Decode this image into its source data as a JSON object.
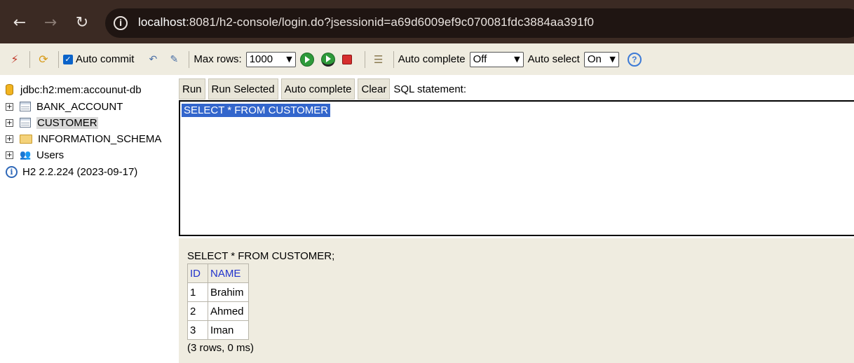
{
  "browser": {
    "url_host": "localhost",
    "url_rest": ":8081/h2-console/login.do?jsessionid=a69d6009ef9c070081fdc3884aa391f0"
  },
  "toolbar": {
    "auto_commit_label": "Auto commit",
    "max_rows_label": "Max rows:",
    "max_rows_value": "1000",
    "auto_complete_label": "Auto complete",
    "auto_complete_value": "Off",
    "auto_select_label": "Auto select",
    "auto_select_value": "On",
    "help_glyph": "?"
  },
  "tree": {
    "connection": "jdbc:h2:mem:accounut-db",
    "items": [
      {
        "label": "BANK_ACCOUNT",
        "icon": "table-icon"
      },
      {
        "label": "CUSTOMER",
        "icon": "table-icon"
      },
      {
        "label": "INFORMATION_SCHEMA",
        "icon": "folder-icon"
      },
      {
        "label": "Users",
        "icon": "users-icon"
      }
    ],
    "version": "H2 2.2.224 (2023-09-17)"
  },
  "editor": {
    "buttons": {
      "run": "Run",
      "run_selected": "Run Selected",
      "auto_complete": "Auto complete",
      "clear": "Clear"
    },
    "sql_label": "SQL statement:",
    "sql_text": "SELECT * FROM CUSTOMER"
  },
  "result": {
    "statement": "SELECT * FROM CUSTOMER;",
    "columns": [
      "ID",
      "NAME"
    ],
    "rows": [
      [
        "1",
        "Brahim"
      ],
      [
        "2",
        "Ahmed"
      ],
      [
        "3",
        "Iman"
      ]
    ],
    "info": "(3 rows, 0 ms)"
  },
  "colors": {
    "chrome": "#3b2a23",
    "panel": "#efece0",
    "selection": "#3366cc",
    "header_link": "#2233cc"
  }
}
